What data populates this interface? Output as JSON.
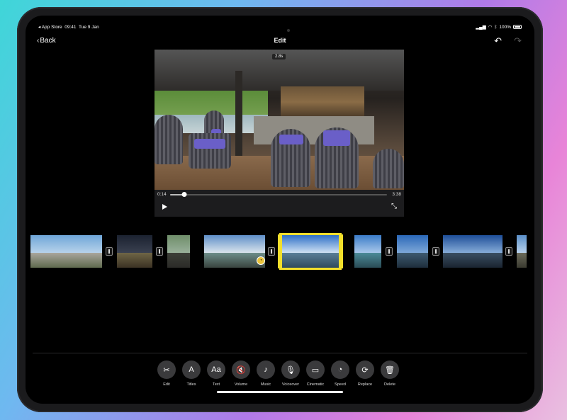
{
  "status_bar": {
    "carrier": "◂ App Store",
    "time": "09:41",
    "date": "Tue 9 Jan",
    "battery": "100%"
  },
  "nav": {
    "back_label": "Back",
    "title": "Edit"
  },
  "viewer": {
    "clip_duration": "2.8s",
    "current_time": "0:14",
    "total_time": "3:38",
    "progress_fraction": 0.064
  },
  "toolbar": {
    "items": [
      {
        "label": "Edit",
        "icon": "scissors-icon",
        "glyph": "✂"
      },
      {
        "label": "Titles",
        "icon": "titles-icon",
        "glyph": "A"
      },
      {
        "label": "Text",
        "icon": "text-icon",
        "glyph": "Aa"
      },
      {
        "label": "Volume",
        "icon": "volume-muted-icon",
        "glyph": "🔇"
      },
      {
        "label": "Music",
        "icon": "music-note-icon",
        "glyph": "♪"
      },
      {
        "label": "Voiceover",
        "icon": "microphone-icon",
        "glyph": "🎙"
      },
      {
        "label": "Cinematic",
        "icon": "camera-icon",
        "glyph": "▭"
      },
      {
        "label": "Speed",
        "icon": "speedometer-icon",
        "glyph": "◔"
      },
      {
        "label": "Replace",
        "icon": "replace-icon",
        "glyph": "⟳"
      },
      {
        "label": "Delete",
        "icon": "trash-icon",
        "glyph": "🗑"
      }
    ]
  },
  "colors": {
    "selection": "#f2df2b",
    "tool_bg": "#3a3a3c"
  }
}
